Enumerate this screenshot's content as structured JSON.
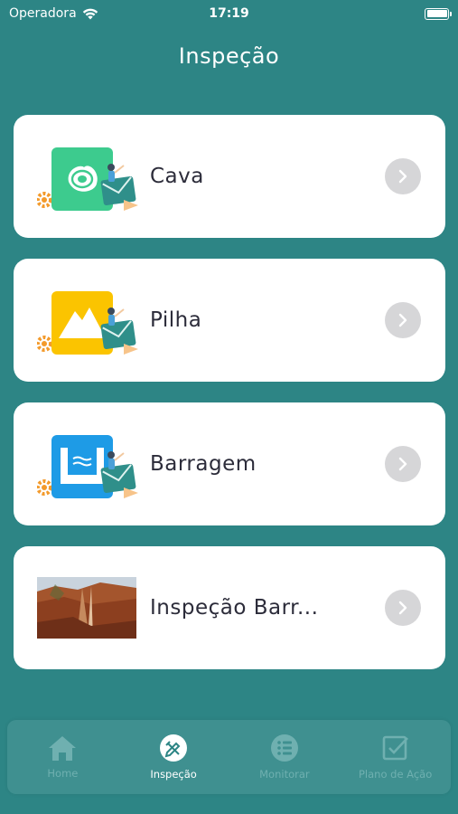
{
  "status": {
    "carrier": "Operadora",
    "time": "17:19"
  },
  "page": {
    "title": "Inspeção"
  },
  "items": [
    {
      "label": "Cava",
      "icon": "cava-icon",
      "color": "#3dcb8e"
    },
    {
      "label": "Pilha",
      "icon": "pilha-icon",
      "color": "#fbc400"
    },
    {
      "label": "Barragem",
      "icon": "barragem-icon",
      "color": "#1e9be6"
    },
    {
      "label": "Inspeção Barr...",
      "icon": "photo-thumbnail"
    }
  ],
  "tabs": [
    {
      "label": "Home",
      "icon": "home-icon",
      "active": false
    },
    {
      "label": "Inspeção",
      "icon": "inspection-icon",
      "active": true
    },
    {
      "label": "Monitorar",
      "icon": "list-icon",
      "active": false
    },
    {
      "label": "Plano de Ação",
      "icon": "checkbox-icon",
      "active": false
    }
  ]
}
